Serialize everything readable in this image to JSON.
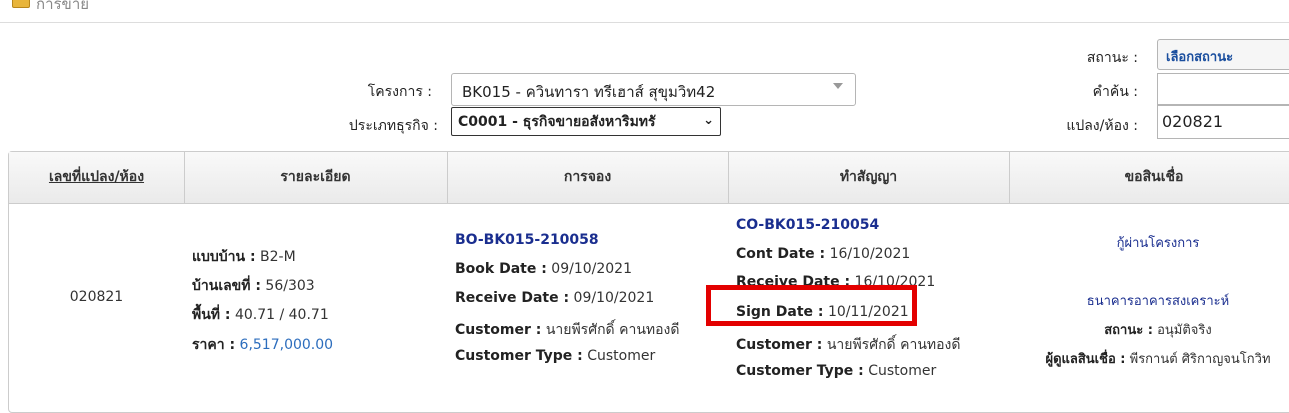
{
  "header": {
    "title": "การขาย"
  },
  "filters": {
    "project_label": "โครงการ :",
    "project_value": "BK015 - ควินทารา ทรีเฮาส์ สุขุมวิท42",
    "business_label": "ประเภทธุรกิจ :",
    "business_value": "C0001 - ธุรกิจขายอสังหาริมทรั",
    "status_label": "สถานะ :",
    "status_value": "เลือกสถานะ",
    "search_label": "คำค้น :",
    "search_value": "",
    "unit_label": "แปลง/ห้อง :",
    "unit_value": "020821"
  },
  "table": {
    "headers": [
      "เลขที่แปลง/ห้อง",
      "รายละเอียด",
      "การจอง",
      "ทำสัญญา",
      "ขอสินเชื่อ"
    ],
    "row": {
      "unit_no": "020821",
      "details": {
        "house_type_label": "แบบบ้าน :",
        "house_type": "B2-M",
        "house_no_label": "บ้านเลขที่ :",
        "house_no": "56/303",
        "area_label": "พื้นที่ :",
        "area": "40.71 / 40.71",
        "price_label": "ราคา :",
        "price": "6,517,000.00"
      },
      "booking": {
        "code": "BO-BK015-210058",
        "book_date_label": "Book Date :",
        "book_date": "09/10/2021",
        "receive_date_label": "Receive Date :",
        "receive_date": "09/10/2021",
        "customer_label": "Customer :",
        "customer": "นายพีรศักดิ์ คานทองดี",
        "customer_type_label": "Customer Type :",
        "customer_type": "Customer"
      },
      "contract": {
        "code": "CO-BK015-210054",
        "cont_date_label": "Cont Date :",
        "cont_date": "16/10/2021",
        "receive_date_label": "Receive Date :",
        "receive_date": "16/10/2021",
        "sign_date_label": "Sign Date :",
        "sign_date": "10/11/2021",
        "customer_label": "Customer :",
        "customer": "นายพีรศักดิ์ คานทองดี",
        "customer_type_label": "Customer Type :",
        "customer_type": "Customer"
      },
      "loan": {
        "link": "กู้ผ่านโครงการ",
        "bank": "ธนาคารอาคารสงเคราะห์",
        "status_label": "สถานะ :",
        "status": "อนุมัติจริง",
        "officer_label": "ผู้ดูแลสินเชื่อ :",
        "officer": "พีรกานต์ ศิริกาญจนโกวิท"
      }
    }
  }
}
